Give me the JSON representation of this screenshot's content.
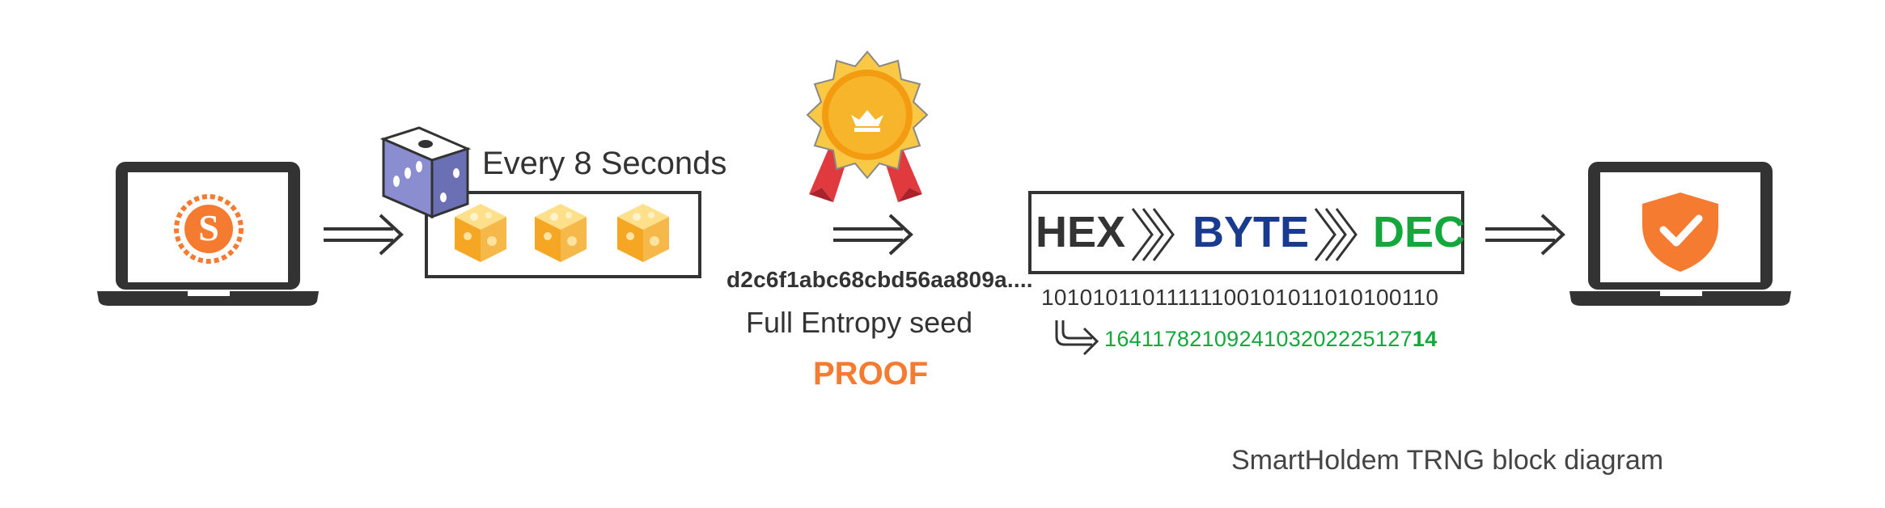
{
  "diagram": {
    "caption": "SmartHoldem TRNG block diagram",
    "timer_label": "Every 8 Seconds",
    "entropy": {
      "hash": "d2c6f1abc68cbd56aa809a....",
      "seed_label": "Full Entropy seed",
      "proof_label": "PROOF"
    },
    "conversion": {
      "hex_label": "HEX",
      "byte_label": "BYTE",
      "dec_label": "DEC",
      "binary": "1010101101111110010101101010011 0",
      "decimal_main": "16411782109241032022251 27",
      "decimal_bold": "14"
    },
    "icons": [
      "smartholdem-logo-icon",
      "dice-icon",
      "block-cube-icon",
      "award-badge-icon",
      "shield-check-icon",
      "double-arrow-icon",
      "chevron-double-icon",
      "hook-arrow-icon"
    ],
    "colors": {
      "orange": "#f47b30",
      "blue": "#1a3a8f",
      "green": "#14a83c",
      "dark": "#333333",
      "dice": "#6b6fb3",
      "gold": "#f7b52c",
      "ribbon": "#e03a3e"
    }
  }
}
